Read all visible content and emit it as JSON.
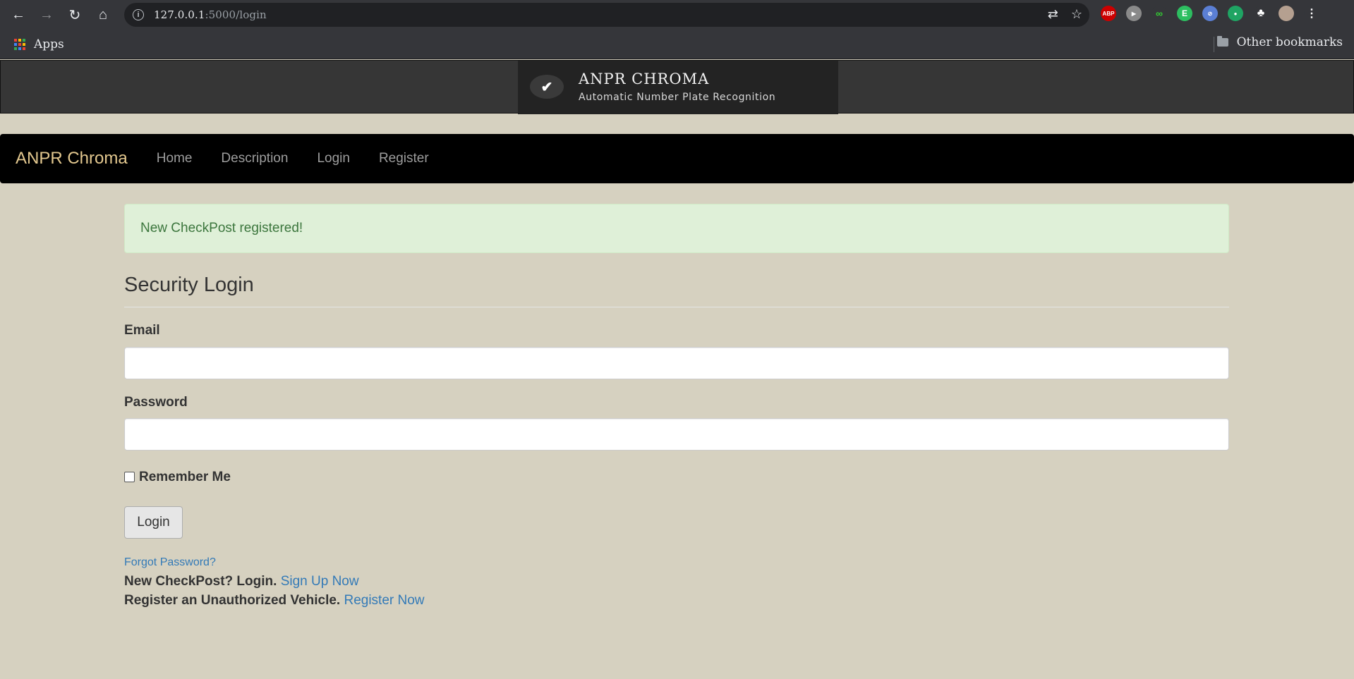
{
  "browser": {
    "url_host": "127.0.0.1",
    "url_path": ":5000/login",
    "bookmarks": {
      "apps_label": "Apps",
      "other_label": "Other bookmarks"
    },
    "extensions": [
      "ABP",
      "play",
      "M",
      "evernote",
      "ext",
      "ext"
    ]
  },
  "header": {
    "title": "ANPR CHROMA",
    "subtitle": "Automatic Number Plate Recognition"
  },
  "navbar": {
    "brand": "ANPR Chroma",
    "links": [
      "Home",
      "Description",
      "Login",
      "Register"
    ]
  },
  "alert": {
    "message": "New CheckPost registered!"
  },
  "form": {
    "legend": "Security Login",
    "email_label": "Email",
    "email_value": "",
    "password_label": "Password",
    "password_value": "",
    "remember_label": "Remember Me",
    "remember_checked": false,
    "submit_label": "Login"
  },
  "footer_links": {
    "forgot": "Forgot Password?",
    "signup_text": "New CheckPost? Login.",
    "signup_link": "Sign Up Now",
    "register_text": "Register an Unauthorized Vehicle.",
    "register_link": "Register Now"
  },
  "colors": {
    "brand": "#e3c88f",
    "link": "#337ab7",
    "alert_bg": "#dff0d8",
    "alert_text": "#3c763d",
    "navbar_bg": "#000000"
  }
}
